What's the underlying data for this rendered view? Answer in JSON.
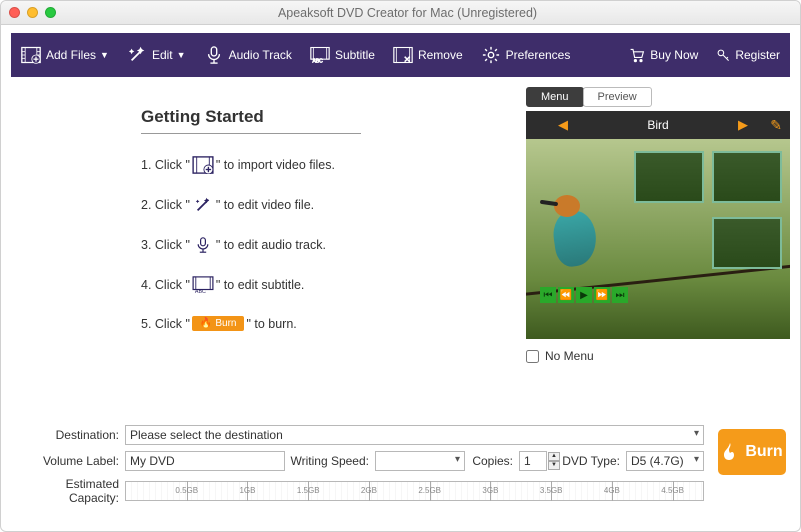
{
  "window": {
    "title": "Apeaksoft DVD Creator for Mac (Unregistered)"
  },
  "toolbar": {
    "add_files": "Add Files",
    "edit": "Edit",
    "audio_track": "Audio Track",
    "subtitle": "Subtitle",
    "remove": "Remove",
    "preferences": "Preferences",
    "buy_now": "Buy Now",
    "register": "Register"
  },
  "getting_started": {
    "title": "Getting Started",
    "step1_a": "1. Click \"",
    "step1_b": "\" to import video files.",
    "step2_a": "2. Click \"",
    "step2_b": "\" to edit video file.",
    "step3_a": "3. Click \"",
    "step3_b": "\" to edit audio track.",
    "step4_a": "4. Click \"",
    "step4_b": "\" to edit subtitle.",
    "step5_a": "5. Click \"",
    "step5_chip": "Burn",
    "step5_b": "\" to burn."
  },
  "preview": {
    "tab_menu": "Menu",
    "tab_preview": "Preview",
    "menu_title": "Bird",
    "no_menu": "No Menu"
  },
  "form": {
    "destination_label": "Destination:",
    "destination_value": "Please select the destination",
    "volume_label": "Volume Label:",
    "volume_value": "My DVD",
    "writing_speed_label": "Writing Speed:",
    "writing_speed_value": "",
    "copies_label": "Copies:",
    "copies_value": "1",
    "dvd_type_label": "DVD Type:",
    "dvd_type_value": "D5 (4.7G)",
    "capacity_label": "Estimated Capacity:",
    "capacity_ticks": [
      "0.5GB",
      "1GB",
      "1.5GB",
      "2GB",
      "2.5GB",
      "3GB",
      "3.5GB",
      "4GB",
      "4.5GB"
    ]
  },
  "burn_button": "Burn"
}
